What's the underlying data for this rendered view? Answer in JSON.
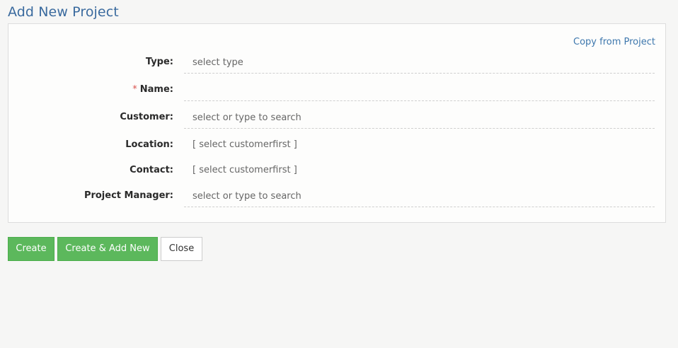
{
  "page": {
    "title": "Add New Project"
  },
  "form": {
    "copy_link": "Copy from Project",
    "fields": {
      "type": {
        "label": "Type:",
        "placeholder": "select type"
      },
      "name": {
        "required_mark": "*",
        "label": "Name:",
        "value": ""
      },
      "customer": {
        "label": "Customer:",
        "placeholder": "select or type to search"
      },
      "location": {
        "label": "Location:",
        "value": "[ select customerfirst ]"
      },
      "contact": {
        "label": "Contact:",
        "value": "[ select customerfirst ]"
      },
      "project_manager": {
        "label": "Project Manager:",
        "placeholder": "select or type to search"
      }
    }
  },
  "actions": {
    "create": "Create",
    "create_add_new": "Create & Add New",
    "close": "Close"
  },
  "colors": {
    "title": "#3a6a9e",
    "link": "#3d77ad",
    "success": "#5cb85c",
    "required": "#d9534f"
  }
}
